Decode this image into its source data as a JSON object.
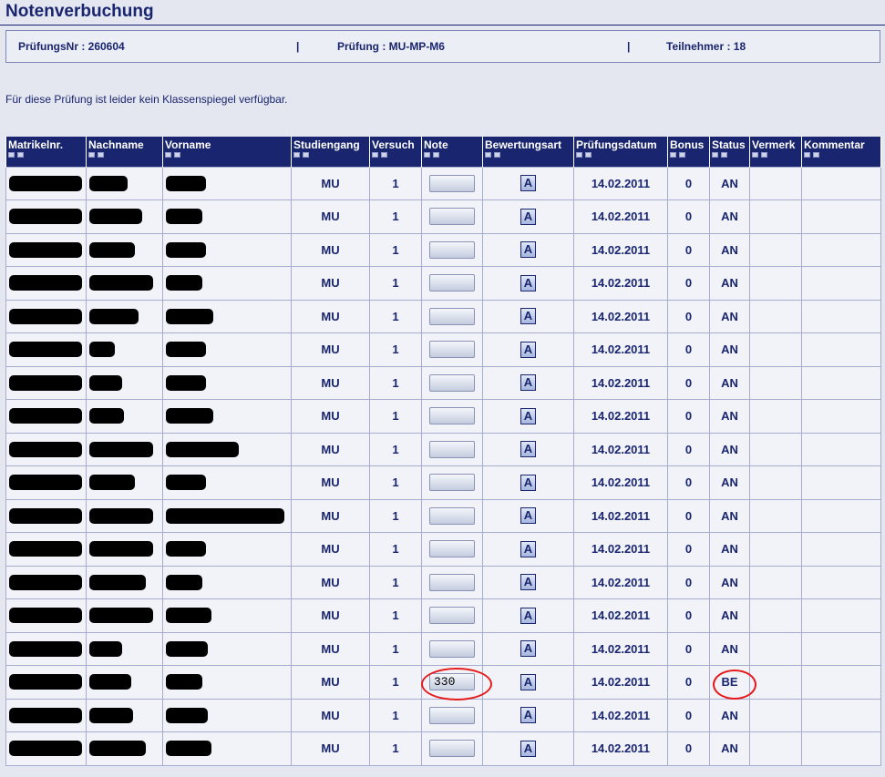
{
  "page": {
    "title": "Notenverbuchung"
  },
  "info": {
    "pruefungsnr": "PrüfungsNr :  260604",
    "pruefung": "Prüfung :  MU-MP-M6",
    "teilnehmer": "Teilnehmer :  18",
    "separator": "|"
  },
  "notice": "Für diese Prüfung ist leider kein Klassenspiegel verfügbar.",
  "table": {
    "headers": [
      "Matrikelnr.",
      "Nachname",
      "Vorname",
      "Studiengang",
      "Versuch",
      "Note",
      "Bewertungsart",
      "Prüfungsdatum",
      "Bonus",
      "Status",
      "Vermerk",
      "Kommentar"
    ],
    "rows": [
      {
        "studiengang": "MU",
        "versuch": "1",
        "note": "",
        "bewertungsart": "A",
        "datum": "14.02.2011",
        "bonus": "0",
        "status": "AN",
        "vermerk": "",
        "kommentar": ""
      },
      {
        "studiengang": "MU",
        "versuch": "1",
        "note": "",
        "bewertungsart": "A",
        "datum": "14.02.2011",
        "bonus": "0",
        "status": "AN",
        "vermerk": "",
        "kommentar": ""
      },
      {
        "studiengang": "MU",
        "versuch": "1",
        "note": "",
        "bewertungsart": "A",
        "datum": "14.02.2011",
        "bonus": "0",
        "status": "AN",
        "vermerk": "",
        "kommentar": ""
      },
      {
        "studiengang": "MU",
        "versuch": "1",
        "note": "",
        "bewertungsart": "A",
        "datum": "14.02.2011",
        "bonus": "0",
        "status": "AN",
        "vermerk": "",
        "kommentar": ""
      },
      {
        "studiengang": "MU",
        "versuch": "1",
        "note": "",
        "bewertungsart": "A",
        "datum": "14.02.2011",
        "bonus": "0",
        "status": "AN",
        "vermerk": "",
        "kommentar": ""
      },
      {
        "studiengang": "MU",
        "versuch": "1",
        "note": "",
        "bewertungsart": "A",
        "datum": "14.02.2011",
        "bonus": "0",
        "status": "AN",
        "vermerk": "",
        "kommentar": ""
      },
      {
        "studiengang": "MU",
        "versuch": "1",
        "note": "",
        "bewertungsart": "A",
        "datum": "14.02.2011",
        "bonus": "0",
        "status": "AN",
        "vermerk": "",
        "kommentar": ""
      },
      {
        "studiengang": "MU",
        "versuch": "1",
        "note": "",
        "bewertungsart": "A",
        "datum": "14.02.2011",
        "bonus": "0",
        "status": "AN",
        "vermerk": "",
        "kommentar": ""
      },
      {
        "studiengang": "MU",
        "versuch": "1",
        "note": "",
        "bewertungsart": "A",
        "datum": "14.02.2011",
        "bonus": "0",
        "status": "AN",
        "vermerk": "",
        "kommentar": ""
      },
      {
        "studiengang": "MU",
        "versuch": "1",
        "note": "",
        "bewertungsart": "A",
        "datum": "14.02.2011",
        "bonus": "0",
        "status": "AN",
        "vermerk": "",
        "kommentar": ""
      },
      {
        "studiengang": "MU",
        "versuch": "1",
        "note": "",
        "bewertungsart": "A",
        "datum": "14.02.2011",
        "bonus": "0",
        "status": "AN",
        "vermerk": "",
        "kommentar": ""
      },
      {
        "studiengang": "MU",
        "versuch": "1",
        "note": "",
        "bewertungsart": "A",
        "datum": "14.02.2011",
        "bonus": "0",
        "status": "AN",
        "vermerk": "",
        "kommentar": ""
      },
      {
        "studiengang": "MU",
        "versuch": "1",
        "note": "",
        "bewertungsart": "A",
        "datum": "14.02.2011",
        "bonus": "0",
        "status": "AN",
        "vermerk": "",
        "kommentar": ""
      },
      {
        "studiengang": "MU",
        "versuch": "1",
        "note": "",
        "bewertungsart": "A",
        "datum": "14.02.2011",
        "bonus": "0",
        "status": "AN",
        "vermerk": "",
        "kommentar": ""
      },
      {
        "studiengang": "MU",
        "versuch": "1",
        "note": "",
        "bewertungsart": "A",
        "datum": "14.02.2011",
        "bonus": "0",
        "status": "AN",
        "vermerk": "",
        "kommentar": ""
      },
      {
        "studiengang": "MU",
        "versuch": "1",
        "note": "330",
        "bewertungsart": "A",
        "datum": "14.02.2011",
        "bonus": "0",
        "status": "BE",
        "vermerk": "",
        "kommentar": ""
      },
      {
        "studiengang": "MU",
        "versuch": "1",
        "note": "",
        "bewertungsart": "A",
        "datum": "14.02.2011",
        "bonus": "0",
        "status": "AN",
        "vermerk": "",
        "kommentar": ""
      },
      {
        "studiengang": "MU",
        "versuch": "1",
        "note": "",
        "bewertungsart": "A",
        "datum": "14.02.2011",
        "bonus": "0",
        "status": "AN",
        "vermerk": "",
        "kommentar": ""
      }
    ]
  },
  "colors": {
    "header_bg": "#19256e",
    "text": "#19256e",
    "highlight": "#e51b1b",
    "redaction": "#000000"
  }
}
